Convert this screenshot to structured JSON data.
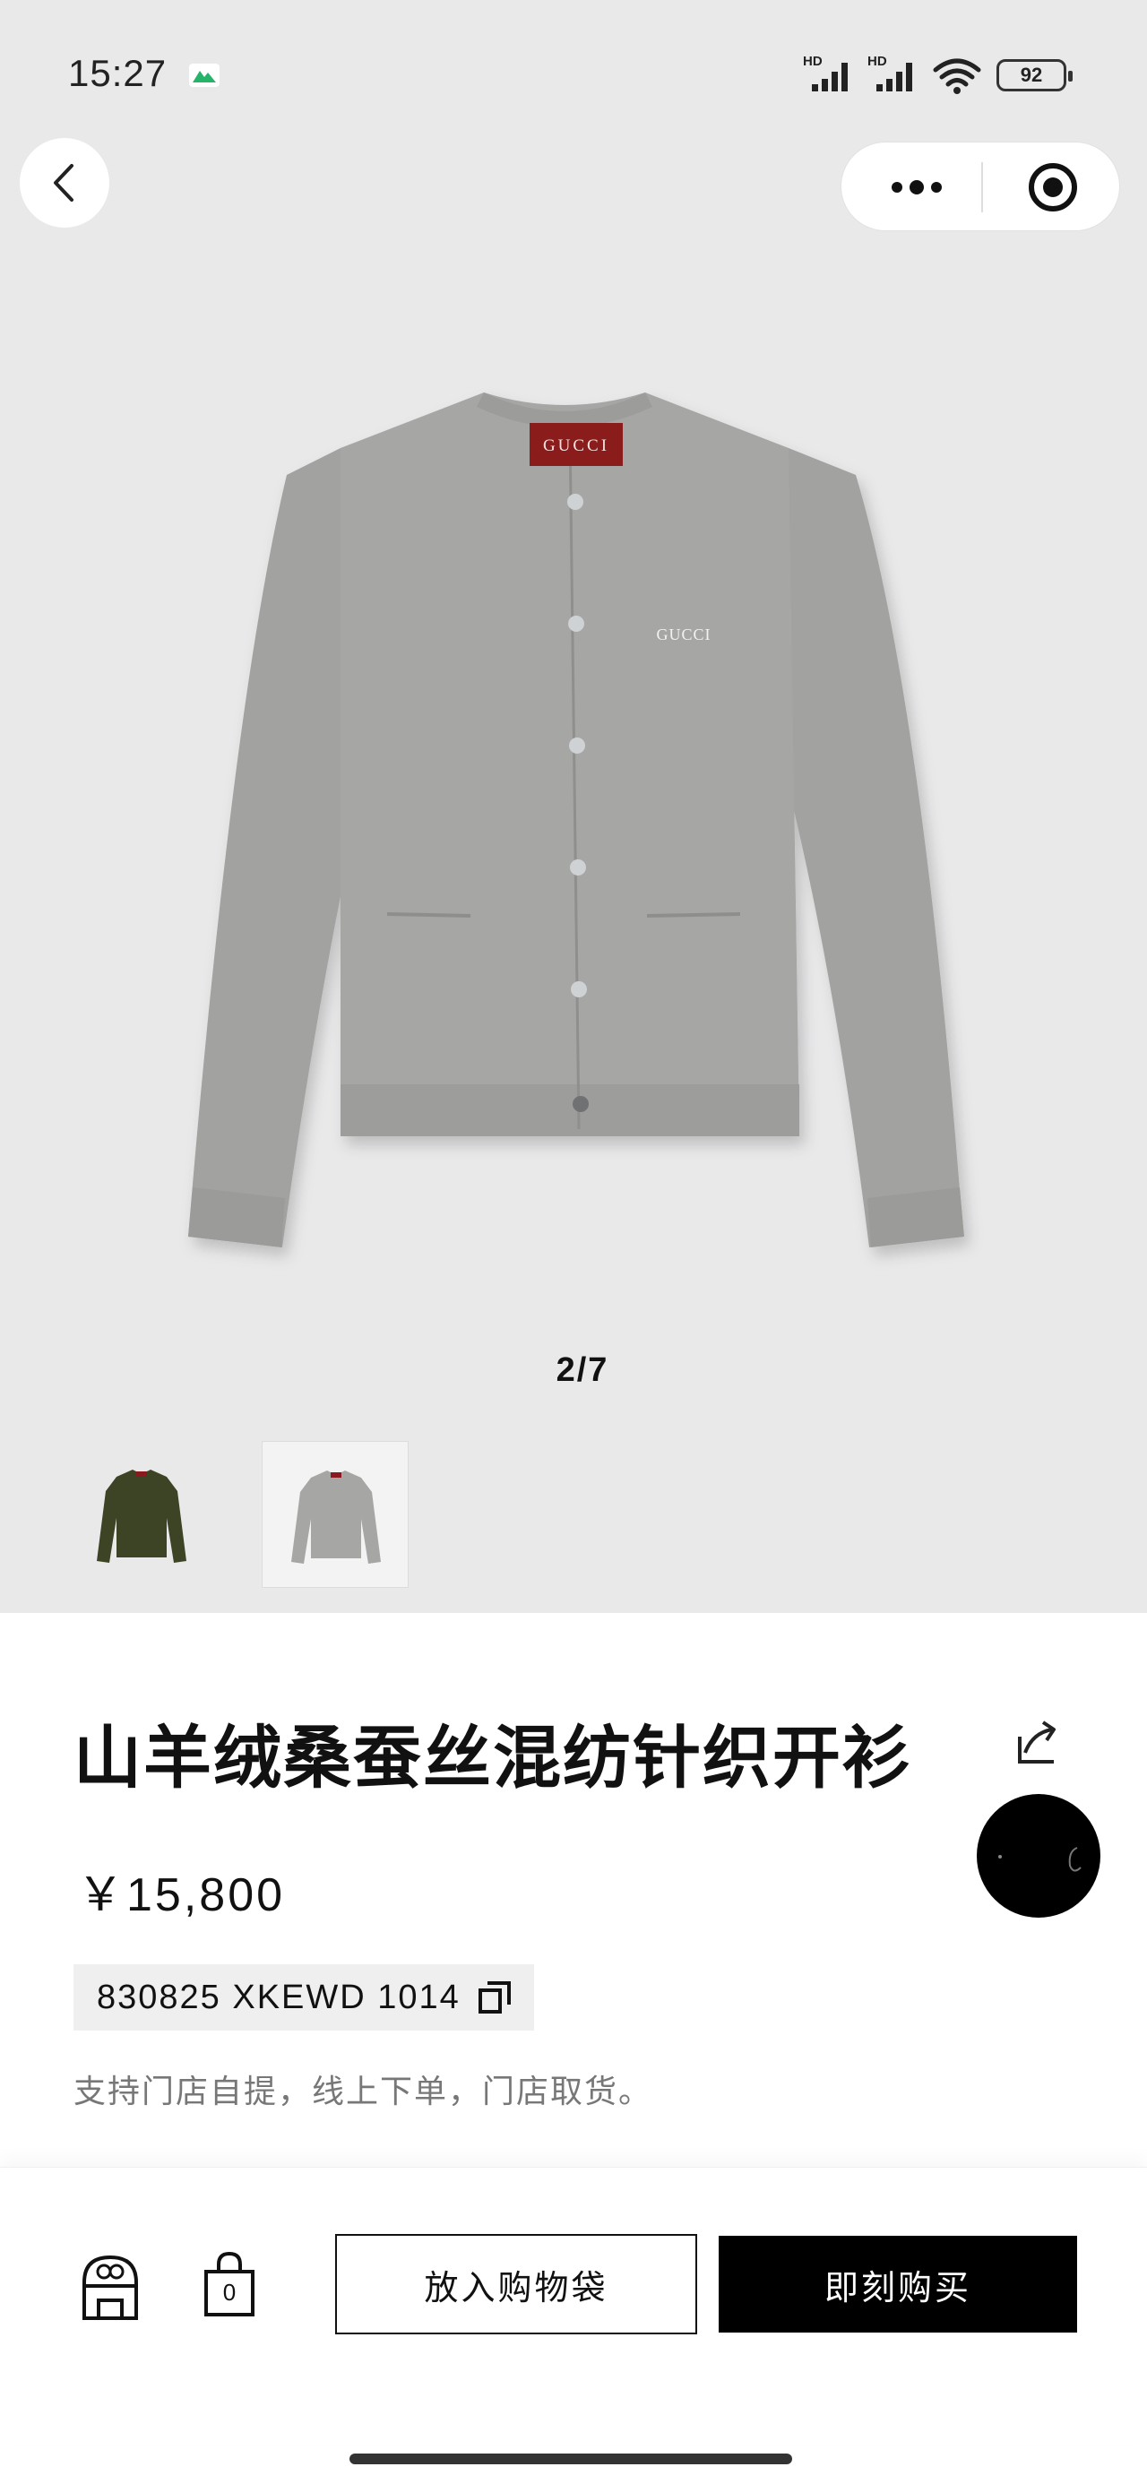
{
  "status_bar": {
    "time": "15:27",
    "signal_label_1": "HD",
    "signal_label_2": "HD",
    "battery": "92"
  },
  "nav": {
    "back_icon": "chevron-left-icon",
    "more_icon": "more-dots-icon",
    "target_icon": "target-icon"
  },
  "gallery": {
    "pager": "2/7",
    "current_index": 2,
    "total": 7,
    "brand_label": "GUCCI"
  },
  "product": {
    "title": "山羊绒桑蚕丝混纺针织开衫",
    "price": "￥15,800",
    "sku": "830825 XKEWD 1014",
    "note": "支持门店自提，线上下单，门店取货。"
  },
  "actions": {
    "store_icon": "store-icon",
    "bag_count": "0",
    "add_to_bag": "放入购物袋",
    "buy_now": "即刻购买"
  },
  "colors": {
    "hero_bg": "#e9e9ea",
    "primary": "#000000",
    "sweater_gray": "#a3a3a1",
    "thumb_green": "#3d4426",
    "label_red": "#8a1a1f"
  }
}
